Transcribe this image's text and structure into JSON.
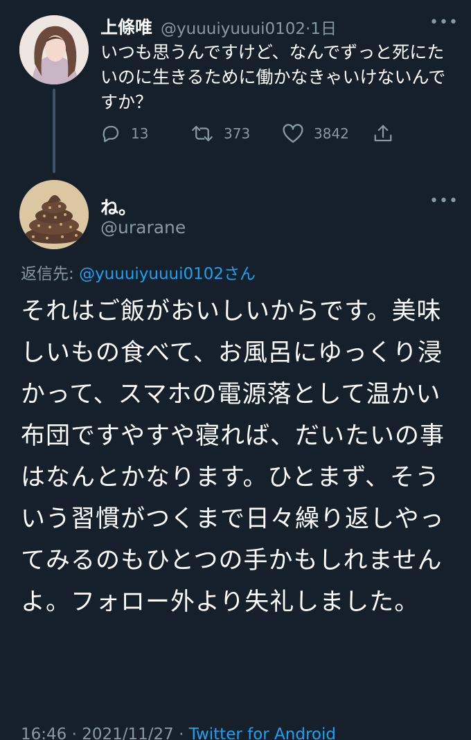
{
  "parent": {
    "name": "上條唯",
    "handle": "@yuuuiyuuui0102",
    "time": "·1日",
    "text": "いつも思うんですけど、なんでずっと死にたいのに生きるために働かなきゃいけないんですか？",
    "counts": {
      "replies": "13",
      "retweets": "373",
      "likes": "3842"
    }
  },
  "main": {
    "name": "ね。",
    "handle": "@urarane",
    "reply_label": "返信先: ",
    "reply_mention": "@yuuuiyuuui0102さん",
    "text": "それはご飯がおいしいからです。美味しいもの食べて、お風呂にゆっくり浸かって、スマホの電源落として温かい布団ですやすや寝れば、だいたいの事はなんとかなります。ひとまず、そういう習慣がつくまで日々繰り返しやってみるのもひとつの手かもしれませんよ。フォロー外より失礼しました。",
    "time": "16:46 · 2021/11/27 · ",
    "source": "Twitter for Android"
  },
  "icons": {
    "more": "more-horizontal-icon",
    "reply": "reply-icon",
    "retweet": "retweet-icon",
    "like": "heart-icon",
    "share": "share-icon"
  },
  "colors": {
    "background": "#15202b",
    "secondary_text": "#8899a6",
    "link": "#1da1f2",
    "thread_line": "#3d5466"
  }
}
